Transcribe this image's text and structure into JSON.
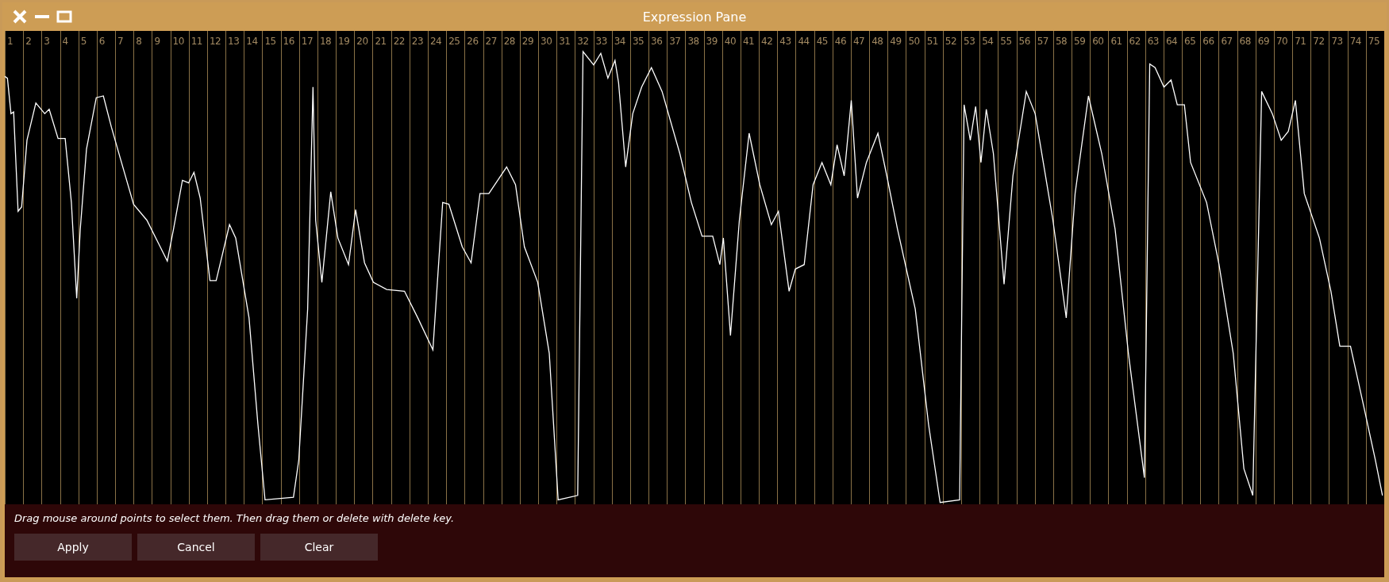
{
  "window": {
    "title": "Expression Pane"
  },
  "bars": [
    "1",
    "2",
    "3",
    "4",
    "5",
    "6",
    "7",
    "8",
    "9",
    "10",
    "11",
    "12",
    "13",
    "14",
    "15",
    "16",
    "17",
    "18",
    "19",
    "20",
    "21",
    "22",
    "23",
    "24",
    "25",
    "26",
    "27",
    "28",
    "29",
    "30",
    "31",
    "32",
    "33",
    "34",
    "35",
    "36",
    "37",
    "38",
    "39",
    "40",
    "41",
    "42",
    "43",
    "44",
    "45",
    "46",
    "47",
    "48",
    "49",
    "50",
    "51",
    "52",
    "53",
    "54",
    "55",
    "56",
    "57",
    "58",
    "59",
    "60",
    "61",
    "62",
    "63",
    "64",
    "65",
    "66",
    "67",
    "68",
    "69",
    "70",
    "71",
    "72",
    "73",
    "74",
    "75"
  ],
  "instruction": "Drag mouse around points to select them. Then drag them or delete with delete key.",
  "buttons": [
    "Apply",
    "Cancel",
    "Clear"
  ]
}
